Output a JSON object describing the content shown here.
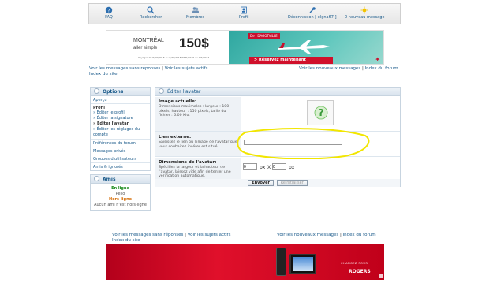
{
  "nav": {
    "items": [
      {
        "label": "FAQ",
        "icon": "help-icon"
      },
      {
        "label": "Rechercher",
        "icon": "search-icon"
      },
      {
        "label": "Membres",
        "icon": "members-icon"
      },
      {
        "label": "Profil",
        "icon": "profile-icon"
      },
      {
        "label": "Déconnexion [ olgna67 ]",
        "icon": "logout-icon"
      },
      {
        "label": "0 nouveau message",
        "icon": "message-icon"
      }
    ]
  },
  "banner": {
    "city": "MONTRÉAL",
    "trip_type": "aller simple",
    "price": "150$",
    "tag": "De : DAGOTVILLE",
    "fine_print": "Voyagez du 6/19/2016 au 6/29/2016/01/9/2016 au 9/7/2022",
    "cta": "> Réservez maintenant"
  },
  "top_links": {
    "unanswered": "Voir les messages sans réponses",
    "active": "Voir les sujets actifs",
    "index": "Index du site",
    "new": "Voir les nouveaux messages",
    "forum_index": "Index du forum",
    "separator": "|"
  },
  "sidebar": {
    "options_title": "Options",
    "apercu": "Aperçu",
    "profil_header": "Profil",
    "profil_items": [
      "» Éditer le profil",
      "» Éditer la signature",
      "» Éditer l'avatar",
      "» Éditer les réglages du compte"
    ],
    "other_items": [
      "Préférences du forum",
      "Messages privés",
      "Groupes d'utilisateurs",
      "Amis & ignorés"
    ],
    "friends_title": "Amis",
    "online_label": "En ligne",
    "online_name": "Pello",
    "offline_label": "Hors-ligne",
    "offline_text": "Aucun ami n'est hors-ligne"
  },
  "main": {
    "title": "Éditer l'avatar",
    "current_title": "Image actuelle:",
    "current_desc": "Dimensions maximales : largeur : 100 pixels, hauteur : 150 pixels, taille du fichier : 6.00 Kio.",
    "link_title": "Lien externe:",
    "link_desc": "Saisissez le lien où l'image de l'avatar que vous souhaitez insérer est situé.",
    "link_value": "",
    "dims_title": "Dimensions de l'avatar:",
    "dims_desc": "Spécifiez la largeur et la hauteur de l'avatar, laissez vide afin de tenter une vérification automatique.",
    "width_value": "0",
    "height_value": "0",
    "px_label": "px",
    "x_label": "X",
    "submit": "Envoyer",
    "reset": "Réinitialiser"
  },
  "ad": {
    "tagline": "CHANGEZ POUR",
    "brand": "ROGERS"
  },
  "colors": {
    "link": "#1a5a8a",
    "annotation": "#f2e600",
    "ad_red": "#e0102b",
    "banner_teal": "#2fa7a0"
  }
}
